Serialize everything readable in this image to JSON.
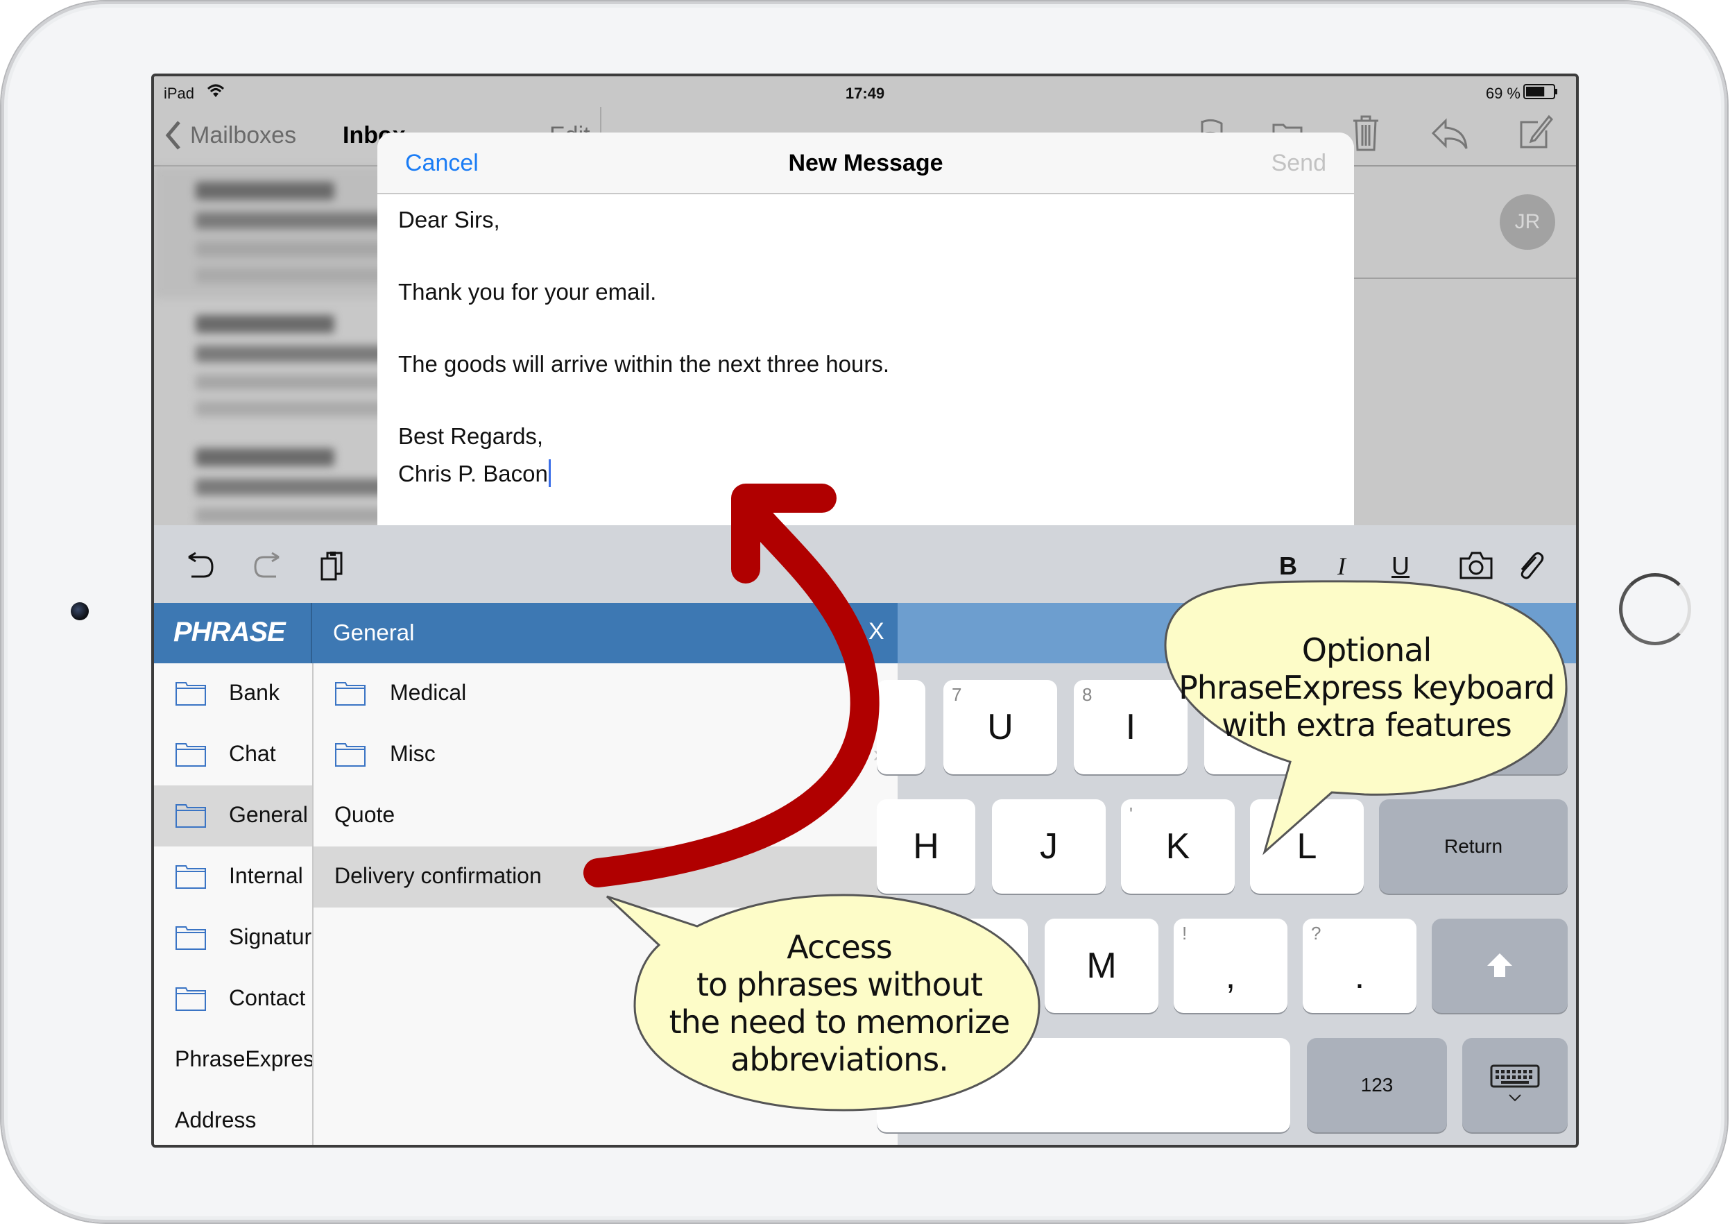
{
  "status_bar": {
    "device": "iPad",
    "time": "17:49",
    "battery": "69 %",
    "battery_level": 0.69
  },
  "mail_nav": {
    "back_label": "Mailboxes",
    "title": "Inbox",
    "edit_label": "Edit"
  },
  "avatar_initials": "JR",
  "compose": {
    "cancel_label": "Cancel",
    "title": "New Message",
    "send_label": "Send",
    "body_lines": [
      "Dear Sirs,",
      "",
      "Thank you for your email.",
      "",
      "The goods will arrive within the next three hours.",
      "",
      "Best Regards,",
      "Chris P. Bacon"
    ]
  },
  "toolbar": {
    "left_icons": [
      "undo-icon",
      "redo-icon",
      "paste-icon"
    ],
    "bold_label": "B",
    "italic_label": "I",
    "underline_label": "U",
    "right_icons": [
      "camera-icon",
      "paperclip-icon"
    ]
  },
  "phrase_panel": {
    "logo_text": "PHRASE",
    "current_folder": "General",
    "close_label": "X",
    "left_items": [
      {
        "label": "Bank",
        "folder": true,
        "selected": false
      },
      {
        "label": "Chat",
        "folder": true,
        "selected": false
      },
      {
        "label": "General",
        "folder": true,
        "selected": true
      },
      {
        "label": "Internal",
        "folder": true,
        "selected": false
      },
      {
        "label": "Signature",
        "folder": true,
        "selected": false
      },
      {
        "label": "Contact",
        "folder": true,
        "selected": false
      },
      {
        "label": "PhraseExpress",
        "folder": false,
        "selected": false
      },
      {
        "label": "Address",
        "folder": false,
        "selected": false
      }
    ],
    "right_items": [
      {
        "label": "Medical",
        "folder": true,
        "selected": false
      },
      {
        "label": "Misc",
        "folder": true,
        "selected": false
      },
      {
        "label": "Quote",
        "folder": false,
        "selected": false
      },
      {
        "label": "Delivery confirmation",
        "folder": false,
        "selected": true
      }
    ]
  },
  "keyboard": {
    "row1": [
      {
        "key": "U",
        "hint": "7"
      },
      {
        "key": "I",
        "hint": "8"
      }
    ],
    "row2": [
      {
        "key": "H",
        "hint": ""
      },
      {
        "key": "J",
        "hint": ""
      },
      {
        "key": "K",
        "hint": "'"
      },
      {
        "key": "L",
        "hint": ""
      }
    ],
    "return_label": "Return",
    "row3": [
      {
        "key": "M",
        "hint": ""
      },
      {
        "key": ",",
        "hint": "!"
      },
      {
        "key": ".",
        "hint": "?"
      }
    ],
    "numbers_label": "123"
  },
  "callouts": {
    "keyboard": [
      "Optional",
      "PhraseExpress keyboard",
      "with extra features"
    ],
    "phrases": [
      "Access",
      "to phrases without",
      "the need to memorize",
      "abbreviations."
    ]
  },
  "colors": {
    "accent_blue": "#1a7cf5",
    "phrase_header": "#3d78b3",
    "callout_fill": "#fdfcc8",
    "arrow_red": "#b00000"
  }
}
